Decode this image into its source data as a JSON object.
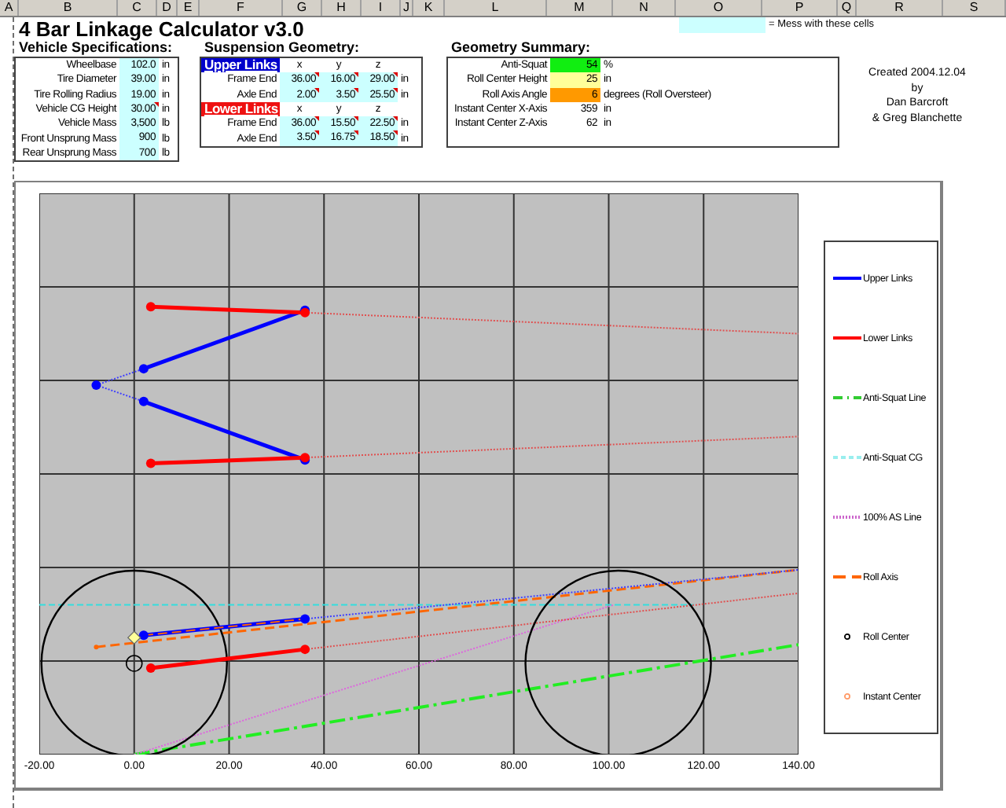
{
  "columns": [
    "A",
    "B",
    "C",
    "D",
    "E",
    "F",
    "G",
    "H",
    "I",
    "J",
    "K",
    "L",
    "M",
    "N",
    "O",
    "P",
    "Q",
    "R",
    "S"
  ],
  "title": "4 Bar Linkage Calculator v3.0",
  "input_legend": {
    "text": "= Mess with these cells"
  },
  "vehicle": {
    "heading": "Vehicle Specifications:",
    "rows": [
      {
        "label": "Wheelbase",
        "value": "102.0",
        "unit": "in",
        "comment": false
      },
      {
        "label": "Tire Diameter",
        "value": "39.00",
        "unit": "in",
        "comment": false
      },
      {
        "label": "Tire Rolling Radius",
        "value": "19.00",
        "unit": "in",
        "comment": false
      },
      {
        "label": "Vehicle CG Height",
        "value": "30.00",
        "unit": "in",
        "comment": true
      },
      {
        "label": "Vehicle Mass",
        "value": "3,500",
        "unit": "lb",
        "comment": false
      },
      {
        "label": "Front Unsprung Mass",
        "value": "900",
        "unit": "lb",
        "comment": false
      },
      {
        "label": "Rear Unsprung Mass",
        "value": "700",
        "unit": "lb",
        "comment": false
      }
    ]
  },
  "suspension": {
    "heading": "Suspension Geometry:",
    "groups": [
      {
        "title": "Upper Links",
        "color": "#0000cc",
        "axes": [
          "x",
          "y",
          "z"
        ],
        "rows": [
          {
            "label": "Frame End",
            "unit": "in",
            "values": [
              {
                "value": "36.00",
                "comment": true
              },
              {
                "value": "16.00",
                "comment": true
              },
              {
                "value": "29.00",
                "comment": true
              }
            ]
          },
          {
            "label": "Axle End",
            "unit": "in",
            "values": [
              {
                "value": "2.00",
                "comment": true
              },
              {
                "value": "3.50",
                "comment": true
              },
              {
                "value": "25.50",
                "comment": true
              }
            ]
          }
        ]
      },
      {
        "title": "Lower Links",
        "color": "#ee1111",
        "axes": [
          "x",
          "y",
          "z"
        ],
        "rows": [
          {
            "label": "Frame End",
            "unit": "in",
            "values": [
              {
                "value": "36.00",
                "comment": true
              },
              {
                "value": "15.50",
                "comment": true
              },
              {
                "value": "22.50",
                "comment": true
              }
            ]
          },
          {
            "label": "Axle End",
            "unit": "in",
            "values": [
              {
                "value": "3.50",
                "comment": true
              },
              {
                "value": "16.75",
                "comment": true
              },
              {
                "value": "18.50",
                "comment": true
              }
            ]
          }
        ]
      }
    ]
  },
  "summary": {
    "heading": "Geometry Summary:",
    "rows": [
      {
        "label": "Anti-Squat",
        "value": "54",
        "unit": "%",
        "color": "#11ee11"
      },
      {
        "label": "Roll Center Height",
        "value": "25",
        "unit": "in",
        "color": "#ffff99"
      },
      {
        "label": "Roll Axis Angle",
        "value": "6",
        "unit": "degrees (Roll Oversteer)",
        "color": "#ff9900"
      },
      {
        "label": "Instant Center X-Axis",
        "value": "359",
        "unit": "in"
      },
      {
        "label": "Instant Center Z-Axis",
        "value": "62",
        "unit": "in"
      }
    ]
  },
  "credits": [
    "Created 2004.12.04",
    "by",
    "Dan Barcroft",
    "& Greg Blanchette"
  ],
  "chart": {
    "x_labels": [
      "-20.00",
      "0.00",
      "20.00",
      "40.00",
      "60.00",
      "80.00",
      "100.00",
      "120.00",
      "140.00"
    ],
    "legend": [
      {
        "label": "Upper Links",
        "kind": "solid",
        "color": "#0000ff"
      },
      {
        "label": "Lower Links",
        "kind": "solid",
        "color": "#ff0000"
      },
      {
        "label": "Anti-Squat Line",
        "kind": "dash-dot",
        "color": "#33cc33"
      },
      {
        "label": "Anti-Squat CG",
        "kind": "dashed",
        "color": "#99eeee"
      },
      {
        "label": "100% AS Line",
        "kind": "dotted",
        "color": "#cc66cc"
      },
      {
        "label": "Roll Axis",
        "kind": "long-dash",
        "color": "#ff6600"
      },
      {
        "label": "Roll Center",
        "kind": "marker",
        "color": "#000000"
      },
      {
        "label": "Instant Center",
        "kind": "marker",
        "color": "#ff9966"
      }
    ]
  }
}
